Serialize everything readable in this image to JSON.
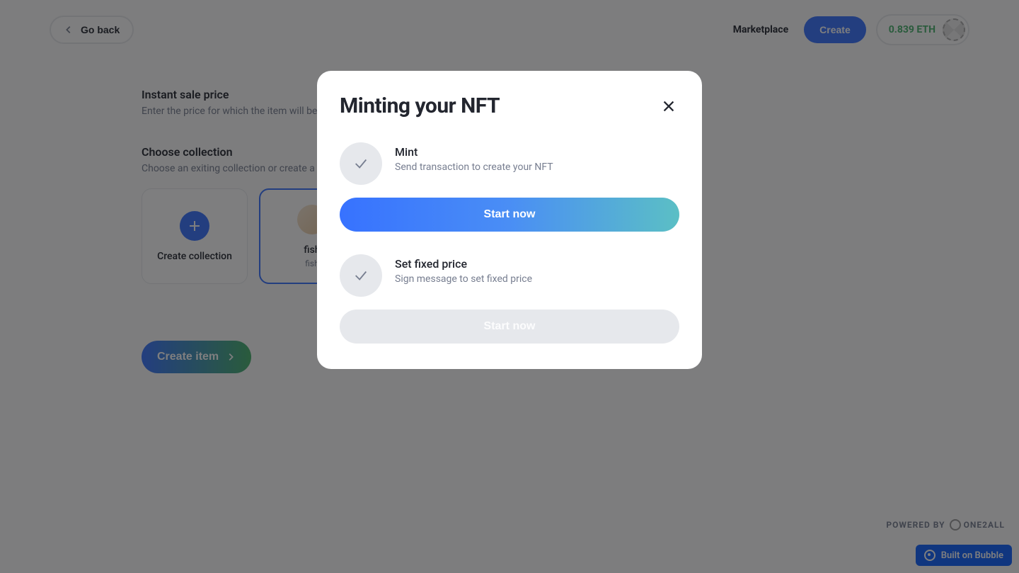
{
  "header": {
    "go_back_label": "Go back",
    "nav_marketplace": "Marketplace",
    "nav_create": "Create",
    "balance": "0.839 ETH"
  },
  "sections": {
    "price_title": "Instant sale price",
    "price_subtitle": "Enter the price for which the item will be instantly sold",
    "collection_title": "Choose collection",
    "collection_subtitle": "Choose an exiting collection or create a new one"
  },
  "collections": {
    "create_label": "Create collection",
    "fish_label": "fish",
    "fish_sublabel": "fish"
  },
  "create_item_label": "Create item",
  "footer": {
    "powered_by": "POWERED BY",
    "one2all": "ONE2ALL"
  },
  "bubble_badge": "Built on Bubble",
  "modal": {
    "title": "Minting your NFT",
    "steps": [
      {
        "title": "Mint",
        "desc": "Send transaction to create your NFT",
        "button": "Start now"
      },
      {
        "title": "Set fixed price",
        "desc": "Sign message to set fixed price",
        "button": "Start now"
      }
    ]
  }
}
